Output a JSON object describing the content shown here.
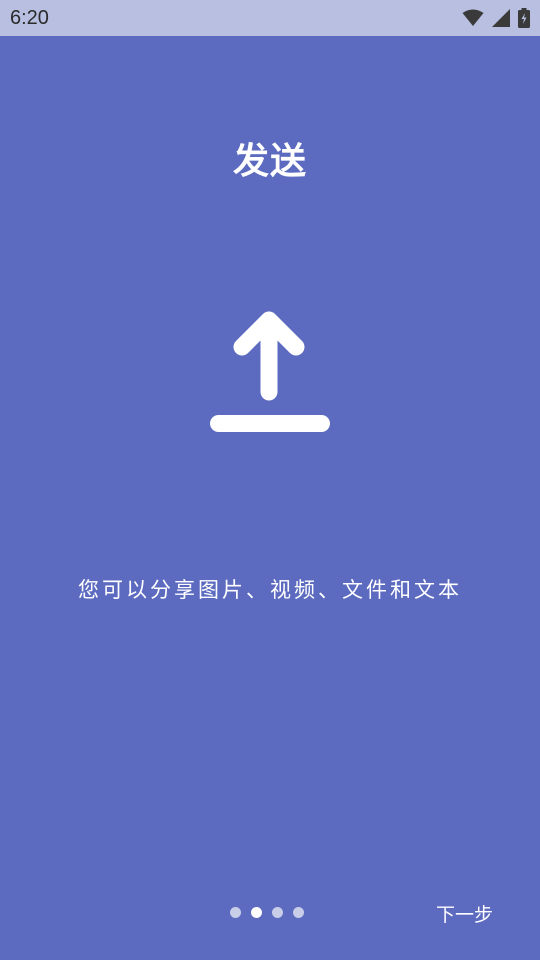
{
  "status_bar": {
    "time": "6:20",
    "icons": [
      "wifi-icon",
      "cellular-signal-icon",
      "battery-icon"
    ]
  },
  "onboarding": {
    "title": "发送",
    "icon": "upload-icon",
    "description": "您可以分享图片、视频、文件和文本",
    "page_indicator": {
      "total": 4,
      "current": 2
    },
    "next_label": "下一步"
  },
  "colors": {
    "background": "#5c6bc0",
    "status_bar": "#b8bfe0",
    "foreground": "#ffffff",
    "dot_inactive": "#c8cde8"
  }
}
